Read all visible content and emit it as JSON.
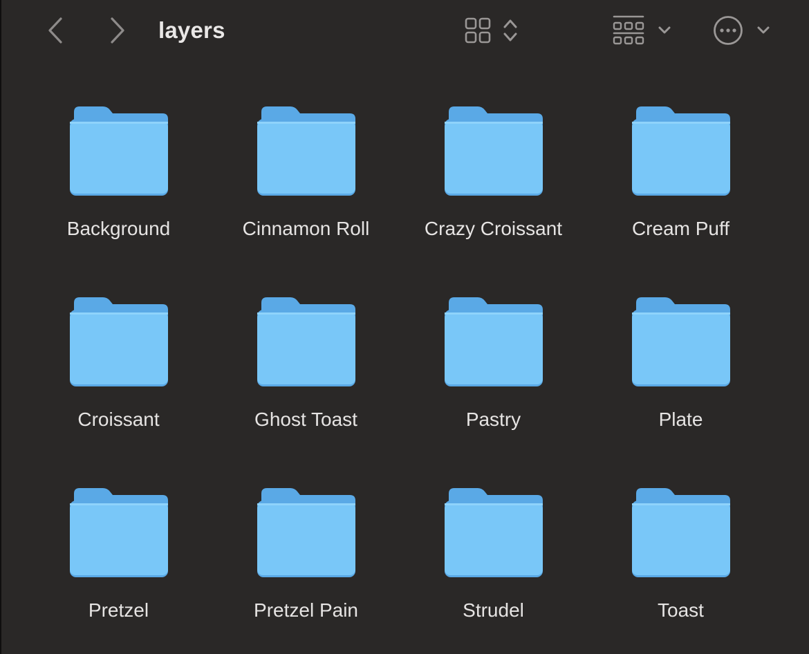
{
  "window": {
    "title": "layers"
  },
  "toolbar": {
    "back_icon": "chevron-left-icon",
    "forward_icon": "chevron-right-icon",
    "view_icon": "icon-grid-view-icon",
    "group_icon": "group-by-icon",
    "more_icon": "ellipsis-circle-icon"
  },
  "colors": {
    "background": "#2a2827",
    "folder_body": "#78c6f7",
    "folder_back": "#5aa9e6",
    "text": "#e6e4e3",
    "icon": "#9a9796"
  },
  "folders": [
    {
      "name": "Background"
    },
    {
      "name": "Cinnamon Roll"
    },
    {
      "name": "Crazy Croissant"
    },
    {
      "name": "Cream Puff"
    },
    {
      "name": "Croissant"
    },
    {
      "name": "Ghost Toast"
    },
    {
      "name": "Pastry"
    },
    {
      "name": "Plate"
    },
    {
      "name": "Pretzel"
    },
    {
      "name": "Pretzel Pain"
    },
    {
      "name": "Strudel"
    },
    {
      "name": "Toast"
    }
  ]
}
